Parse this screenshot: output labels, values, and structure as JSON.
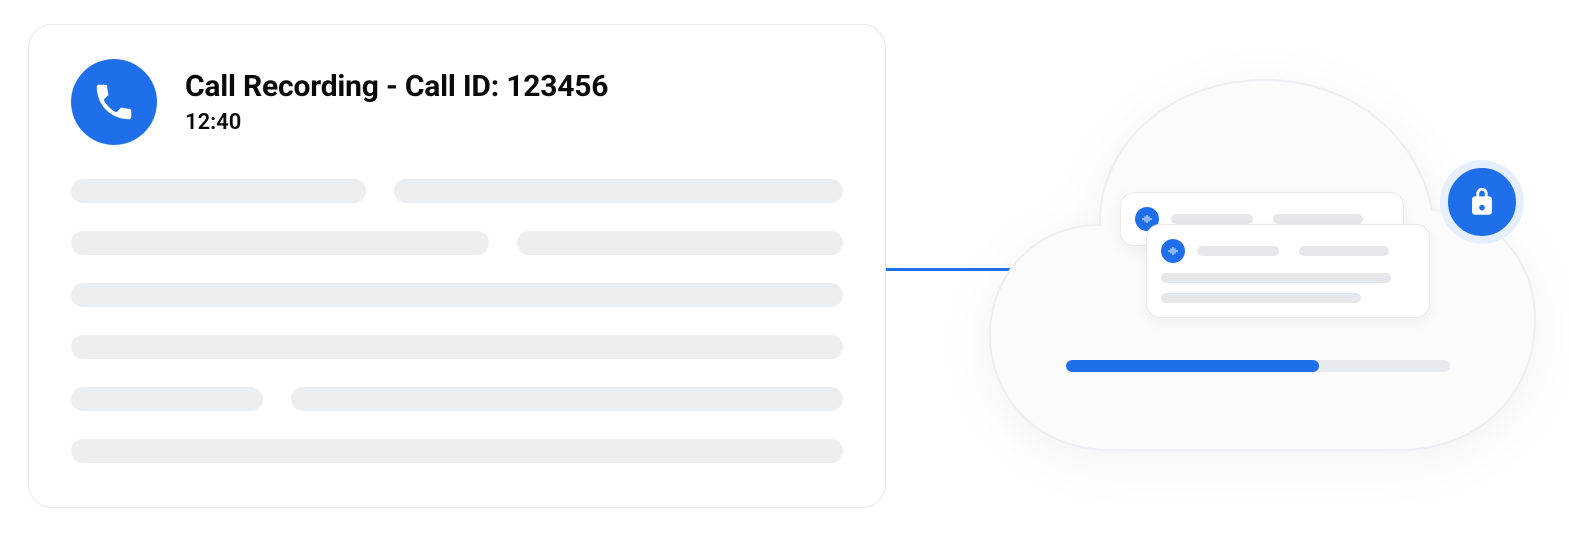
{
  "call": {
    "title": "Call Recording - Call ID: 123456",
    "time": "12:40"
  },
  "icons": {
    "phone": "phone-icon",
    "lock": "lock-icon",
    "audio": "audio-wave-icon"
  },
  "colors": {
    "accent": "#1f6fea",
    "placeholder": "#eceef0",
    "border": "#e6e7ea"
  },
  "cloud": {
    "progress_pct": 66
  }
}
